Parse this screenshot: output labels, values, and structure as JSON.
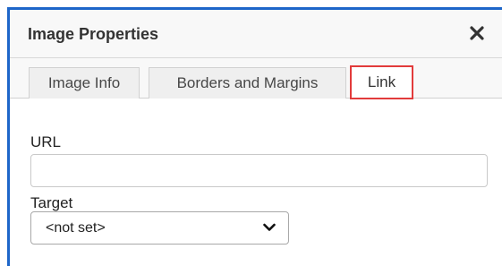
{
  "dialog": {
    "title": "Image Properties",
    "close_icon": "close-icon"
  },
  "tabs": [
    {
      "label": "Image Info",
      "active": false
    },
    {
      "label": "Borders and Margins",
      "active": false
    },
    {
      "label": "Link",
      "active": true,
      "highlight_color": "#e23b3b"
    }
  ],
  "form": {
    "url_label": "URL",
    "url_value": "",
    "target_label": "Target",
    "target_selected": "<not set>",
    "target_icon": "chevron-down-icon"
  },
  "colors": {
    "accent_border": "#1e66c9",
    "tab_highlight": "#e23b3b"
  }
}
